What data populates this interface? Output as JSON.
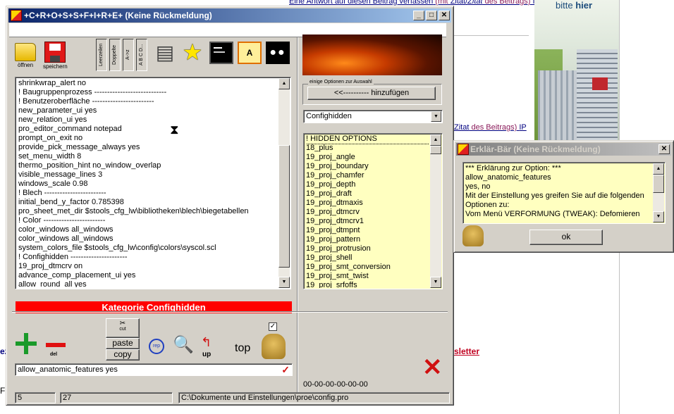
{
  "background": {
    "link_top": "Eine Antwort auf diesen Beitrag verfassen",
    "link_top_rest_1": " (mit ",
    "link_top_zitat": "Zitat",
    "link_top_zitat2": "Zitat",
    "link_top_rest_2": " des Beitrags) ",
    "link_top_ip": "IP",
    "link_mid_zitat": "Zitat",
    "link_mid_rest": " des Beitrags) ",
    "link_mid_ip": "IP",
    "newsletter": "sletter",
    "left_fragment_1": "ez",
    "left_fragment_2": "Fi",
    "ad_text_1": "bitte ",
    "ad_text_2": "hier"
  },
  "main_window": {
    "title": "+C+R+O+S+S+F+I+R+E+ (Keine Rückmeldung)",
    "toolbar": {
      "open_label": "öffnen",
      "save_label": "speichern",
      "vbtn_1": "Leerzeilen",
      "vbtn_2": "Doppelte",
      "vbtn_3": "A->z",
      "vbtn_4": "A B C D..."
    },
    "config_lines": [
      "shrinkwrap_alert no",
      "! Baugruppenprozess ----------------------------",
      "! Benutzeroberfläche ------------------------",
      "new_parameter_ui yes",
      "new_relation_ui yes",
      "pro_editor_command notepad",
      "prompt_on_exit no",
      "provide_pick_message_always yes",
      "set_menu_width 8",
      "thermo_position_hint no_window_overlap",
      "visible_message_lines 3",
      "windows_scale 0.98",
      "! Blech ------------------------",
      "initial_bend_y_factor 0.785398",
      "pro_sheet_met_dir $stools_cfg_lw\\bibliotheken\\blech\\biegetabellen",
      "! Color ------------------------",
      "color_windows all_windows",
      "color_windows all_windows",
      "system_colors_file $stools_cfg_lw\\config\\colors\\syscol.scl",
      "! Confighidden ----------------------",
      "19_proj_dtmcrv on",
      "advance_comp_placement_ui yes",
      "allow_round_all yes"
    ],
    "category_label": "Kategorie Confighidden",
    "options_group_label": "einige Optionen zur Auswahl",
    "add_button": "<<----------  hinzufügen",
    "combo_value": "Confighidden",
    "hidden_options": [
      "! HIDDEN OPTIONS",
      "18_plus",
      "19_proj_angle",
      "19_proj_boundary",
      "19_proj_chamfer",
      "19_proj_depth",
      "19_proj_draft",
      "19_proj_dtmaxis",
      "19_proj_dtmcrv",
      "19_proj_dtmcrv1",
      "19_proj_dtmpnt",
      "19_proj_pattern",
      "19_proj_protrusion",
      "19_proj_shell",
      "19_proj_smt_conversion",
      "19_proj_smt_twist",
      "19_proj_srfoffs"
    ],
    "edit_buttons": {
      "cut": "cut",
      "paste": "paste",
      "copy": "copy",
      "del": "del",
      "up": "up",
      "top": "top"
    },
    "edit_value": "allow_anatomic_features yes",
    "timestamp": "00-00-00-00-00-00",
    "status": {
      "line": "5",
      "count": "27",
      "path": "C:\\Dokumente und Einstellungen\\proe\\config.pro"
    }
  },
  "explain_window": {
    "title": "Erklär-Bär (Keine Rückmeldung)",
    "text_lines": [
      "*** Erklärung zur Option: ***",
      "allow_anatomic_features",
      "yes, no",
      "Mit der Einstellung yes greifen Sie auf die folgenden",
      "Optionen zu:",
      "Vom Menü VERFORMUNG (TWEAK): Defomieren"
    ],
    "ok_button": "ok"
  },
  "colors": {
    "title_active": "#0a246a",
    "title_inactive": "#808080",
    "category_bar": "#ff0000",
    "list_bg": "#ffffc0",
    "face": "#d4d0c8"
  }
}
